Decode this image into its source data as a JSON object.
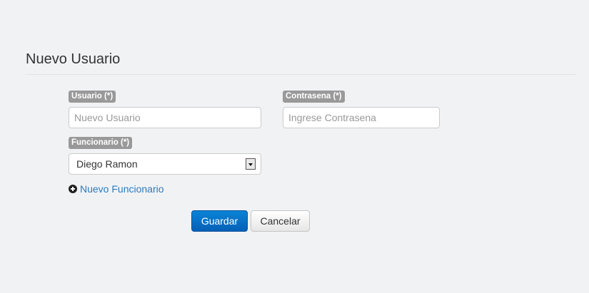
{
  "page": {
    "title": "Nuevo Usuario"
  },
  "form": {
    "usuario": {
      "label": "Usuario (*)",
      "placeholder": "Nuevo Usuario",
      "value": ""
    },
    "contrasena": {
      "label": "Contrasena (*)",
      "placeholder": "Ingrese Contrasena",
      "value": ""
    },
    "funcionario": {
      "label": "Funcionario (*)",
      "selected": "Diego Ramon"
    },
    "add_funcionario_link": "Nuevo Funcionario",
    "buttons": {
      "save": "Guardar",
      "cancel": "Cancelar"
    }
  },
  "icons": {
    "add": "plus-circle-icon",
    "dropdown": "chevron-down-icon"
  },
  "colors": {
    "primary": "#0a75cc",
    "link": "#2a7bbf",
    "label_badge": "#999999",
    "background": "#f1f2f4"
  }
}
